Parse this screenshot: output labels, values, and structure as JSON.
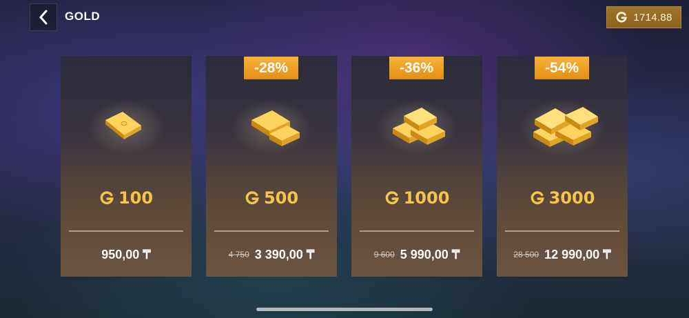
{
  "header": {
    "title": "GOLD",
    "back_icon": "chevron-left-icon",
    "balance": "1714.88",
    "currency_icon": "gold-g-icon"
  },
  "colors": {
    "accent_gold": "#f5c54a",
    "badge_orange": "#f0a224",
    "balance_bg": "#9a6e26"
  },
  "offers": [
    {
      "amount": "100",
      "badge": "",
      "old_price": "",
      "price": "950,00 ₸"
    },
    {
      "amount": "500",
      "badge": "-28%",
      "old_price": "4 750",
      "price": "3 390,00 ₸"
    },
    {
      "amount": "1000",
      "badge": "-36%",
      "old_price": "9 600",
      "price": "5 990,00 ₸"
    },
    {
      "amount": "3000",
      "badge": "-54%",
      "old_price": "28 500",
      "price": "12 990,00 ₸"
    }
  ]
}
